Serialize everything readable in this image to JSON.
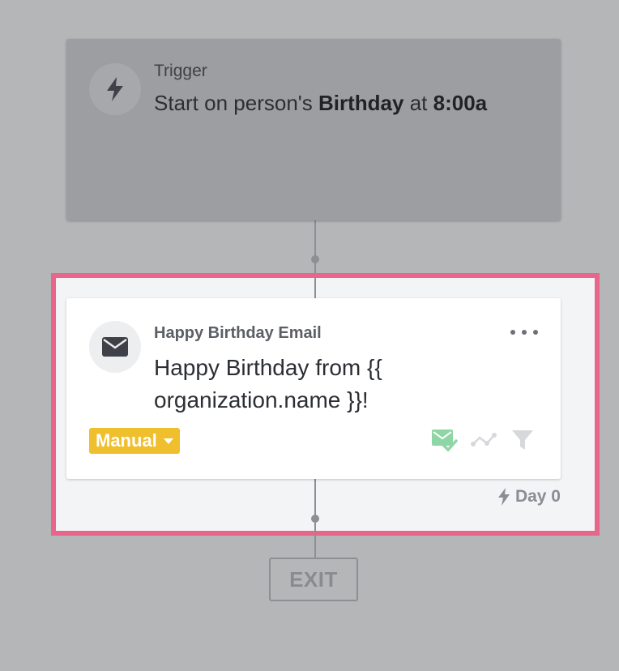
{
  "trigger": {
    "label": "Trigger",
    "desc_prefix": "Start on person's",
    "desc_field": "Birthday",
    "desc_mid": "at",
    "desc_time": "8:00a",
    "icon": "lightning-bolt-icon"
  },
  "email_step": {
    "title": "Happy Birthday Email",
    "subject": "Happy Birthday from {{ organization.name }}!",
    "icon": "envelope-icon",
    "more_icon": "more-dots-icon",
    "send_mode": "Manual",
    "status_icons": [
      "email-check-icon",
      "connector-path-icon",
      "filter-icon"
    ],
    "delay": "Day 0"
  },
  "exit": {
    "label": "EXIT"
  },
  "colors": {
    "background": "#b5b6b8",
    "selection_border": "#e8668b",
    "manual_badge": "#f0bf2e",
    "email_check": "#8fd6a6"
  }
}
